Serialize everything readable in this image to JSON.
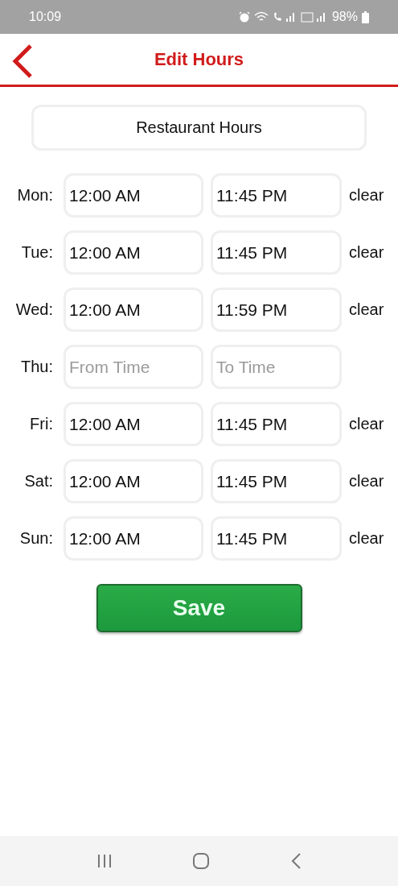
{
  "status_bar": {
    "time": "10:09",
    "battery": "98%"
  },
  "header": {
    "title": "Edit Hours"
  },
  "section": {
    "label": "Restaurant Hours"
  },
  "days": [
    {
      "day": "Mon:",
      "from": {
        "value": "12:00 AM"
      },
      "to": {
        "value": "11:45 PM"
      },
      "clear": "clear"
    },
    {
      "day": "Tue:",
      "from": {
        "value": "12:00 AM"
      },
      "to": {
        "value": "11:45 PM"
      },
      "clear": "clear"
    },
    {
      "day": "Wed:",
      "from": {
        "value": "12:00 AM"
      },
      "to": {
        "value": "11:59 PM"
      },
      "clear": "clear"
    },
    {
      "day": "Thu:",
      "from": {
        "placeholder": "From Time"
      },
      "to": {
        "placeholder": "To Time"
      }
    },
    {
      "day": "Fri:",
      "from": {
        "value": "12:00 AM"
      },
      "to": {
        "value": "11:45 PM"
      },
      "clear": "clear"
    },
    {
      "day": "Sat:",
      "from": {
        "value": "12:00 AM"
      },
      "to": {
        "value": "11:45 PM"
      },
      "clear": "clear"
    },
    {
      "day": "Sun:",
      "from": {
        "value": "12:00 AM"
      },
      "to": {
        "value": "11:45 PM"
      },
      "clear": "clear"
    }
  ],
  "save_button": "Save"
}
